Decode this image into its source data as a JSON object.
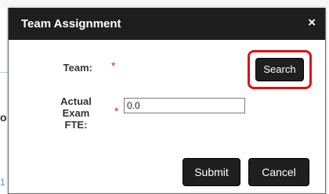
{
  "background": {
    "left_fragment": "o",
    "bottom_fragment": "1"
  },
  "dialog": {
    "title": "Team Assignment",
    "close_glyph": "×"
  },
  "form": {
    "team": {
      "label": "Team:",
      "required_marker": "*",
      "search_label": "Search"
    },
    "fte": {
      "label_line1": "Actual",
      "label_line2": "Exam",
      "label_line3": "FTE:",
      "required_marker": "*",
      "value": "0.0"
    }
  },
  "actions": {
    "submit_label": "Submit",
    "cancel_label": "Cancel"
  },
  "colors": {
    "header_bg": "#1e1e1e",
    "button_bg": "#1f1f1f",
    "required": "#cc2222",
    "highlight": "#e01010"
  }
}
